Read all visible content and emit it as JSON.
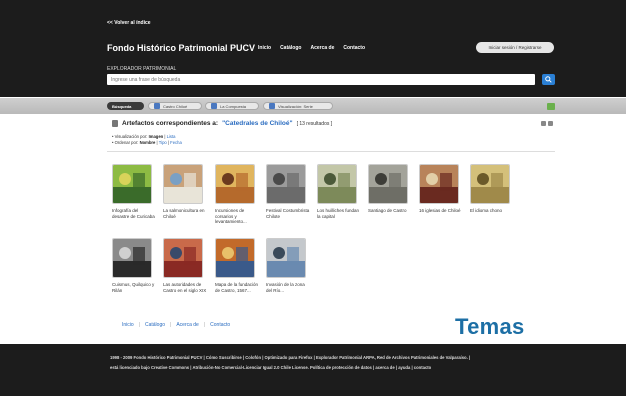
{
  "header": {
    "back_link": "<< Volver al índice",
    "site_title": "Fondo Histórico Patrimonial PUCV",
    "nav": [
      "Inicio",
      "Catálogo",
      "Acerca de",
      "Contacto"
    ],
    "login_label": "Iniciar sesión / Registrarse",
    "explorer_label": "EXPLORADOR PATRIMONIAL",
    "search_placeholder": "Ingrese una frase de búsqueda",
    "search_icon": "search-icon"
  },
  "tabs": [
    "Búsqueda",
    "Castro Chiloé",
    "La Compuesta",
    "Visualización: Serie"
  ],
  "results": {
    "label": "Artefactos correspondientes a:",
    "query": "\"Catedrales de Chiloé\"",
    "count": "[ 13 resultados ]",
    "view_label": "Visualización por:",
    "view_current": "Imagen",
    "view_alt": "Lista",
    "sort_label": "Ordenar por:",
    "sort_current": "Nombre",
    "sort_alt1": "Tipo",
    "sort_alt2": "Fecha"
  },
  "items": [
    {
      "caption": "Infografía del desastre de Curicaba",
      "palette": [
        "#3a6b2a",
        "#8dbb43",
        "#d8d35a"
      ]
    },
    {
      "caption": "La salmonicultura en Chiloé",
      "palette": [
        "#e8e4d8",
        "#c9a27a",
        "#7aa0c4"
      ]
    },
    {
      "caption": "Incursiones de corsarios y levantamiento...",
      "palette": [
        "#b56a2c",
        "#e0b55e",
        "#6b3a1e"
      ]
    },
    {
      "caption": "Festival Costumbrista Chilote",
      "palette": [
        "#6b6b6b",
        "#9b9b9b",
        "#4a4a4a"
      ]
    },
    {
      "caption": "Los huilliches fundan la capital",
      "palette": [
        "#7d8a5a",
        "#c3c7a8",
        "#4c5a3a"
      ]
    },
    {
      "caption": "Santiago de Castro",
      "palette": [
        "#6e6e66",
        "#a3a39a",
        "#3d3d38"
      ]
    },
    {
      "caption": "16 iglesias de Chiloé",
      "palette": [
        "#6a2a20",
        "#b8835a",
        "#e2cfa8"
      ]
    },
    {
      "caption": "El idioma chono",
      "palette": [
        "#a08a4a",
        "#d4c07a",
        "#6b5a2a"
      ]
    },
    {
      "caption": "Cuismus, Quilquico y Rilán",
      "palette": [
        "#2a2a2a",
        "#8a8a8a",
        "#d0d0d0"
      ]
    },
    {
      "caption": "Las autoridades de Castro en el siglo XIX",
      "palette": [
        "#8a2a24",
        "#c96a4a",
        "#3a4a6a"
      ]
    },
    {
      "caption": "Mapa de la fundación de Castro, 1567...",
      "palette": [
        "#3a5a8a",
        "#c26a2a",
        "#e8c06a"
      ]
    },
    {
      "caption": "Invasión de la zona del Río...",
      "palette": [
        "#6a8ab0",
        "#c4c8cc",
        "#3a4a5a"
      ]
    }
  ],
  "bottom_nav": [
    "Inicio",
    "Catálogo",
    "Acerca de",
    "Contacto"
  ],
  "temas_label": "Temas",
  "footer": {
    "line1": "1998 - 2009 Fondo Histórico Patrimonial PUCV | Cómo Suscribirse | Colofón | Optimizado para Firefox | Explorador Patrimonial ARPA, Red de Archivos Patrimoniales de Valparaíso. |",
    "line2": "está licenciado bajo Creative Commons | Atribución-No Comercial-Licenciar Igual 2.0 Chile License. Política de protección de datos | acerca de | ayuda | contacto"
  },
  "colors": {
    "accent": "#2a6cc0",
    "temas": "#1d6fa5",
    "dark_bg": "#1c1c1c"
  }
}
